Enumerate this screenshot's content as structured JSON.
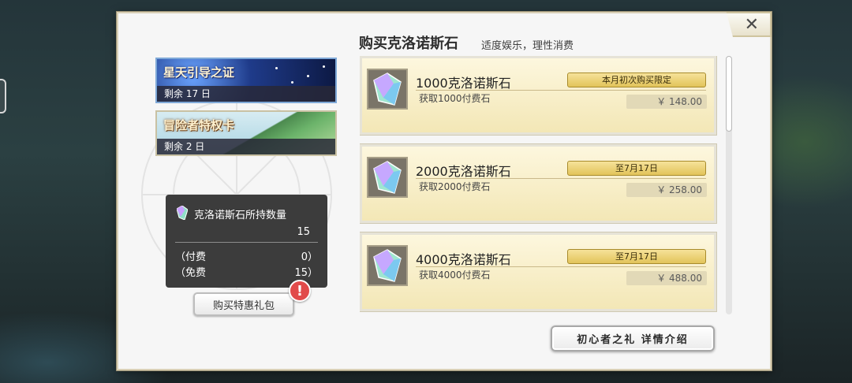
{
  "header": {
    "title": "购买克洛诺斯石",
    "subtitle": "适度娱乐，理性消费",
    "close_label": "✕"
  },
  "banners": [
    {
      "name": "星天引导之证",
      "remaining": "剩余 17 日"
    },
    {
      "name": "冒险者特权卡",
      "remaining": "剩余 2 日"
    }
  ],
  "holding": {
    "label": "克洛诺斯石所持数量",
    "total": "15",
    "paid_label": "（付费",
    "paid_value": "0）",
    "free_label": "（免费",
    "free_value": "15）"
  },
  "gift_button": {
    "label": "购买特惠礼包",
    "badge": "!"
  },
  "products": [
    {
      "name": "1000克洛诺斯石",
      "desc": "获取1000付费石",
      "tag": "本月初次购买限定",
      "price": "￥ 148.00"
    },
    {
      "name": "2000克洛诺斯石",
      "desc": "获取2000付费石",
      "tag": "至7月17日",
      "price": "￥ 258.00"
    },
    {
      "name": "4000克洛诺斯石",
      "desc": "获取4000付费石",
      "tag": "至7月17日",
      "price": "￥ 488.00"
    }
  ],
  "detail_button": {
    "label": "初心者之礼 详情介绍"
  },
  "colors": {
    "card_bg": "#f3e7b6",
    "tag_gold": "#e2c45a",
    "alert_red": "#e14a4a",
    "holding_bg": "#3c3c3c"
  },
  "icons": {
    "close": "close-icon",
    "crystal": "crystal-icon",
    "alert": "exclamation-icon"
  }
}
